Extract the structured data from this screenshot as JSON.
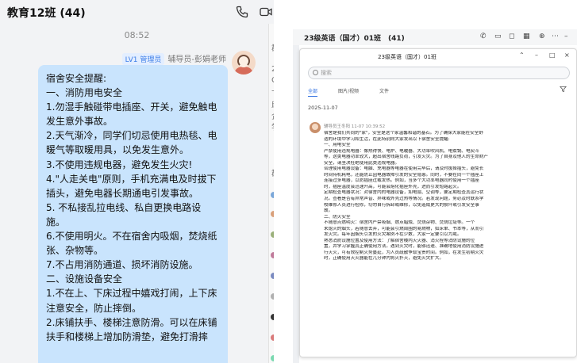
{
  "left": {
    "title": "教育12班 (44)",
    "time": "08:52",
    "sender": {
      "badge": "LV1 管理员",
      "name": "辅导员-彭娟老师"
    },
    "message_lines": [
      "宿舍安全提醒:",
      "一、消防用电安全",
      "1.勿湿手触碰带电插座、开关，避免触电",
      "发生意外事故。",
      "2.天气渐冷，同学们切忌使用电热毯、电",
      "暖气等取暖用具，以免发生意外。",
      "3.不使用违规电器，避免发生火灾!",
      "4.\"人走关电\"原则，手机充满电及时拔下",
      "插头，避免电器长期通电引发事故。",
      "5. 不私接乱拉电线、私自更换电路设",
      "施。",
      "6.不使用明火。不在宿舍内吸烟，焚烧纸",
      "张、杂物等。",
      "7.不占用消防通道、损坏消防设施。",
      "二、设施设备安全",
      "1.不在上、下床过程中嬉戏打闹，上下床",
      "注意安全，防止摔倒。",
      "2.床铺扶手、楼梯注意防滑。可以在床铺",
      "扶手和楼梯上增加防滑垫，避免打滑摔"
    ],
    "edge_texts": [
      "群",
      "20",
      "C",
      "下",
      "助",
      "企",
      "学",
      "群"
    ]
  },
  "right": {
    "top_title": "23级英语（国才）01班　(41)",
    "dialog_title": "23级英语（国才）01班",
    "search_placeholder": "搜索",
    "tabs": [
      "全部",
      "图片/视频",
      "文件"
    ],
    "date": "2025-11-07",
    "meta": "辅导员王冬阳 11-07 10:39:52",
    "body_lines": [
      "宿舍是我们共同的\"家\"，安全是这个家温馨和谐的基石。为了确保大家能在安全舒",
      "适的环境中学习和生活，在此特别向大家发出以下宿舍安全提醒:",
      "一、用电安全",
      "严禁使用违规电器：像热得快、电炉、电暖器、大功率吹风机、电煮锅、电熨斗",
      "等，这类电器功率较大，超出宿舍线路负荷，引发火灾。为了自身及他人的生命财产",
      "安全，请坚决杜绝使用此类违规电器。",
      "合理使用电器设备：电脑、充电器等电器在使用完毕后，请及时拔掉插头，避免长",
      "时间待机耗电，还能防止因电器故障引发的安全隐患。同时，不要在同一个插座上",
      "连接过多电器，以防插座过载发热。例如，当多个大功率电器同时使用一个插座",
      "时，插座温度会迅速升高，可能会熔化插座外壳，进而引发短路起火。",
      "定期检查电器状况：对宿舍内的电器设备，如电扇、空调等，要定期检查其运行状",
      "况。查看是否有异常声音、异味或外壳过热等情况。若发现问题，务必及时联系学",
      "校维修人员进行检修，切勿自行拆卸或维修，以免造成更大的损坏或引发安全事",
      "故。",
      "二、防火安全",
      "不随意点燃明火：宿舍内严禁吸烟、燃点蜡烛、焚烧杂物、焚烧垃圾等。一个",
      "未熄灭的烟头，若随意丢弃，可能会引燃周围的易燃物，如床单、书本等，从而引",
      "发火灾。每年因烟头引发的火灾案例不在少数，大家一定要引以为戒。",
      "熟悉消防设施位置及使用方法：了解宿舍楼内灭火器、消火栓等消防设施的位",
      "置，并学习掌握其正确使用方法。遇到火灾时，能够迅速、准确地使用消防设施进",
      "行灭火，可有效控制火势蔓延，为人员疏散争取宝贵时间。例如，在发生初期火灾",
      "时，正确使用灭火器能在几分钟内将火扑灭，避免火灾扩大。"
    ]
  }
}
